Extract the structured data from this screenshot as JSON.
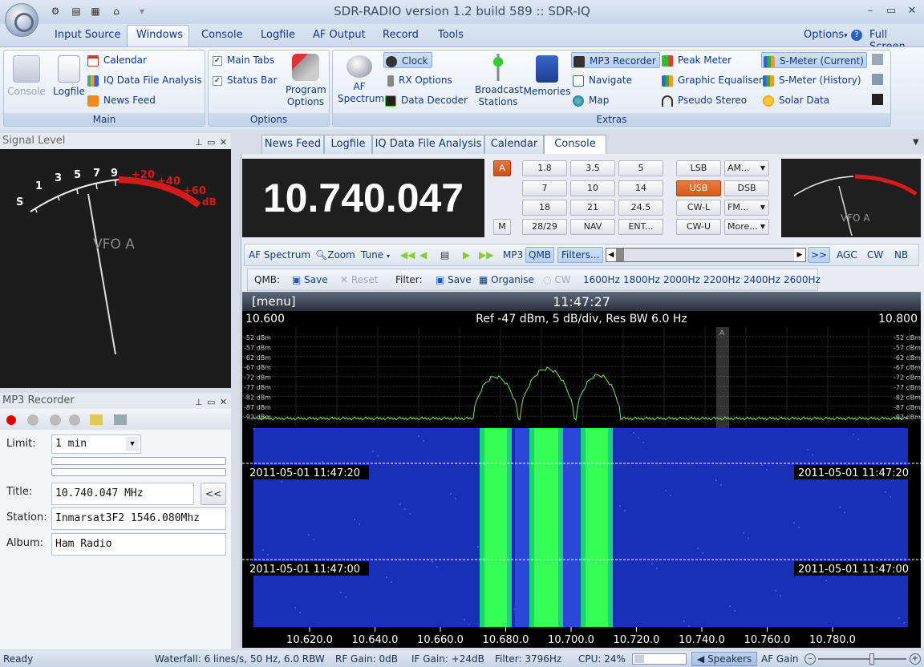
{
  "window": {
    "title": "SDR-RADIO version 1.2  build 589 :: SDR-IQ",
    "min": "–",
    "max": "▭",
    "close": "✕"
  },
  "menu": {
    "items": [
      "Input Source",
      "Windows",
      "Console",
      "Logfile",
      "AF Output",
      "Record",
      "Tools"
    ],
    "options": "Options",
    "help": "?",
    "fullscreen": "Full Screen"
  },
  "ribbon": {
    "main": {
      "label": "Main",
      "console": "Console",
      "logfile": "Logfile",
      "calendar": "Calendar",
      "iq": "IQ Data File Analysis",
      "news": "News Feed"
    },
    "options": {
      "label": "Options",
      "main_tabs": "Main Tabs",
      "status_bar": "Status Bar",
      "program_options": "Program Options"
    },
    "extras": {
      "label": "Extras",
      "af_spectrum": "AF Spectrum",
      "clock": "Clock",
      "rx_options": "RX Options",
      "data_decoder": "Data Decoder",
      "broadcast": "Broadcast Stations",
      "memories": "Memories",
      "mp3": "MP3 Recorder",
      "navigate": "Navigate",
      "map": "Map",
      "peak": "Peak Meter",
      "geq": "Graphic Equaliser",
      "pseudo": "Pseudo Stereo",
      "smeter_cur": "S-Meter (Current)",
      "smeter_hist": "S-Meter (History)",
      "solar": "Solar Data"
    }
  },
  "signal": {
    "title": "Signal Level",
    "scale": [
      "S",
      "1",
      "3",
      "5",
      "7",
      "9"
    ],
    "scale_red": [
      "+20",
      "+40",
      "+60"
    ],
    "unit": "dB",
    "vfo": "VFO A"
  },
  "mp3": {
    "title": "MP3 Recorder",
    "limit_label": "Limit:",
    "limit": "1 min",
    "title_label": "Title:",
    "title_value": "10.740.047 MHz",
    "back": "<<",
    "station_label": "Station:",
    "station": "Inmarsat3F2 1546.080Mhz",
    "album_label": "Album:",
    "album": "Ham Radio"
  },
  "tabs": [
    "News Feed",
    "Logfile",
    "IQ Data File Analysis",
    "Calendar",
    "Console"
  ],
  "console": {
    "freq": "10.740.047",
    "a": "A",
    "m": "M",
    "bands": [
      "1.8",
      "3.5",
      "5",
      "7",
      "10",
      "14",
      "18",
      "21",
      "24.5",
      "28/29",
      "NAV",
      "ENT..."
    ],
    "modes": [
      "LSB",
      "AM...",
      "USB",
      "DSB",
      "CW-L",
      "FM...",
      "CW-U",
      "More..."
    ],
    "smeter_vfo": "VFO A"
  },
  "toolbar1": {
    "af": "AF Spectrum",
    "zoom": "Zoom",
    "tune": "Tune",
    "mp3": "MP3",
    "qmb": "QMB",
    "filters": "Filters...",
    "more": ">>",
    "agc": "AGC",
    "cw": "CW",
    "nb": "NB"
  },
  "toolbar2": {
    "qmb": "QMB:",
    "save": "Save",
    "reset": "Reset",
    "filter": "Filter:",
    "save2": "Save",
    "organise": "Organise",
    "cw": "CW",
    "bw": [
      "1600Hz",
      "1800Hz",
      "2000Hz",
      "2200Hz",
      "2400Hz",
      "2600Hz"
    ]
  },
  "spectrum": {
    "menu": "[menu]",
    "time": "11:47:27",
    "left": "10.600",
    "right": "10.800",
    "info": "Ref -47 dBm,  5 dB/div,  Res BW 6.0 Hz",
    "dbm": [
      "-52 dBm",
      "-57 dBm",
      "-62 dBm",
      "-67 dBm",
      "-72 dBm",
      "-77 dBm",
      "-82 dBm",
      "-87 dBm",
      "-92 dBm"
    ],
    "ts1": "2011-05-01  11:47:20",
    "ts2": "2011-05-01  11:47:00",
    "xticks": [
      "10.620.0",
      "10.640.0",
      "10.660.0",
      "10.680.0",
      "10.700.0",
      "10.720.0",
      "10.740.0",
      "10.760.0",
      "10.780.0"
    ],
    "marker": "A"
  },
  "status": {
    "ready": "Ready",
    "waterfall": "Waterfall: 6 lines/s, 50 Hz, 6.0 RBW",
    "rf": "RF Gain: 0dB",
    "if": "IF Gain: +24dB",
    "filter": "Filter: 3796Hz",
    "cpu": "CPU: 24%",
    "speakers": "Speakers",
    "afgain": "AF Gain"
  }
}
